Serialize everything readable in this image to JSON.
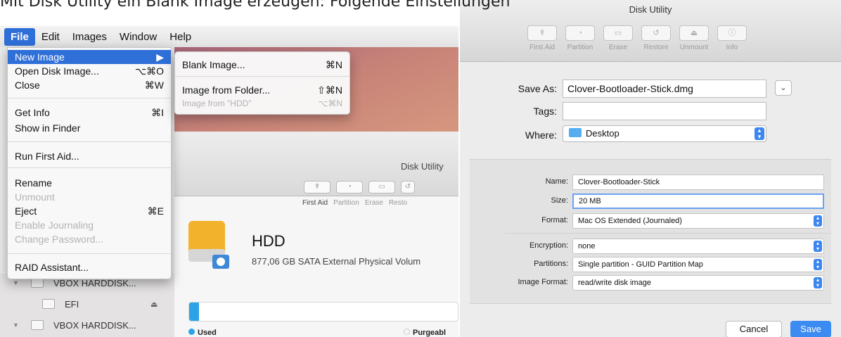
{
  "caption": "Mit Disk Utility ein Blank Image erzeugen: Folgende Einstellungen",
  "menubar": {
    "items": [
      "File",
      "Edit",
      "Images",
      "Window",
      "Help"
    ]
  },
  "file_menu": {
    "items": [
      {
        "label": "New Image",
        "shortcut": "▶",
        "state": "highlighted"
      },
      {
        "label": "Open Disk Image...",
        "shortcut": "⌥⌘O",
        "state": "enabled"
      },
      {
        "label": "Close",
        "shortcut": "⌘W",
        "state": "enabled"
      },
      {
        "label": "Get Info",
        "shortcut": "⌘I",
        "state": "enabled"
      },
      {
        "label": "Show in Finder",
        "shortcut": "",
        "state": "enabled"
      },
      {
        "label": "Run First Aid...",
        "shortcut": "",
        "state": "enabled"
      },
      {
        "label": "Rename",
        "shortcut": "",
        "state": "enabled"
      },
      {
        "label": "Unmount",
        "shortcut": "",
        "state": "disabled"
      },
      {
        "label": "Eject",
        "shortcut": "⌘E",
        "state": "enabled"
      },
      {
        "label": "Enable Journaling",
        "shortcut": "",
        "state": "disabled"
      },
      {
        "label": "Change Password...",
        "shortcut": "",
        "state": "disabled"
      },
      {
        "label": "RAID Assistant...",
        "shortcut": "",
        "state": "enabled"
      }
    ]
  },
  "submenu": {
    "items": [
      {
        "label": "Blank Image...",
        "shortcut": "⌘N",
        "state": "enabled"
      },
      {
        "label": "Image from Folder...",
        "shortcut": "⇧⌘N",
        "state": "enabled"
      },
      {
        "label": "Image from \"HDD\"",
        "shortcut": "⌥⌘N",
        "state": "disabled"
      }
    ]
  },
  "left_window": {
    "title": "Disk Utility",
    "toolbar": [
      "First Aid",
      "Partition",
      "Erase",
      "Resto"
    ],
    "disk_name": "HDD",
    "disk_desc": "877,06 GB SATA External Physical Volum",
    "legend_used": "Used",
    "legend_purgeable": "Purgeabl",
    "sidebar": [
      {
        "label": "VBOX HARDDISK..."
      },
      {
        "label": "EFI"
      },
      {
        "label": "VBOX HARDDISK..."
      }
    ]
  },
  "right_window": {
    "title": "Disk Utility",
    "toolbar": [
      "First Aid",
      "Partition",
      "Erase",
      "Restore",
      "Unmount",
      "Info"
    ],
    "save_as_label": "Save As:",
    "save_as_value": "Clover-Bootloader-Stick.dmg",
    "tags_label": "Tags:",
    "tags_value": "",
    "where_label": "Where:",
    "where_value": "Desktop",
    "name_label": "Name:",
    "name_value": "Clover-Bootloader-Stick",
    "size_label": "Size:",
    "size_value": "20 MB",
    "format_label": "Format:",
    "format_value": "Mac OS Extended (Journaled)",
    "encryption_label": "Encryption:",
    "encryption_value": "none",
    "partitions_label": "Partitions:",
    "partitions_value": "Single partition - GUID Partition Map",
    "image_format_label": "Image Format:",
    "image_format_value": "read/write disk image",
    "cancel_label": "Cancel",
    "save_label": "Save"
  },
  "colors": {
    "accent": "#3b8bf2",
    "menu_highlight": "#2f6fd8"
  }
}
